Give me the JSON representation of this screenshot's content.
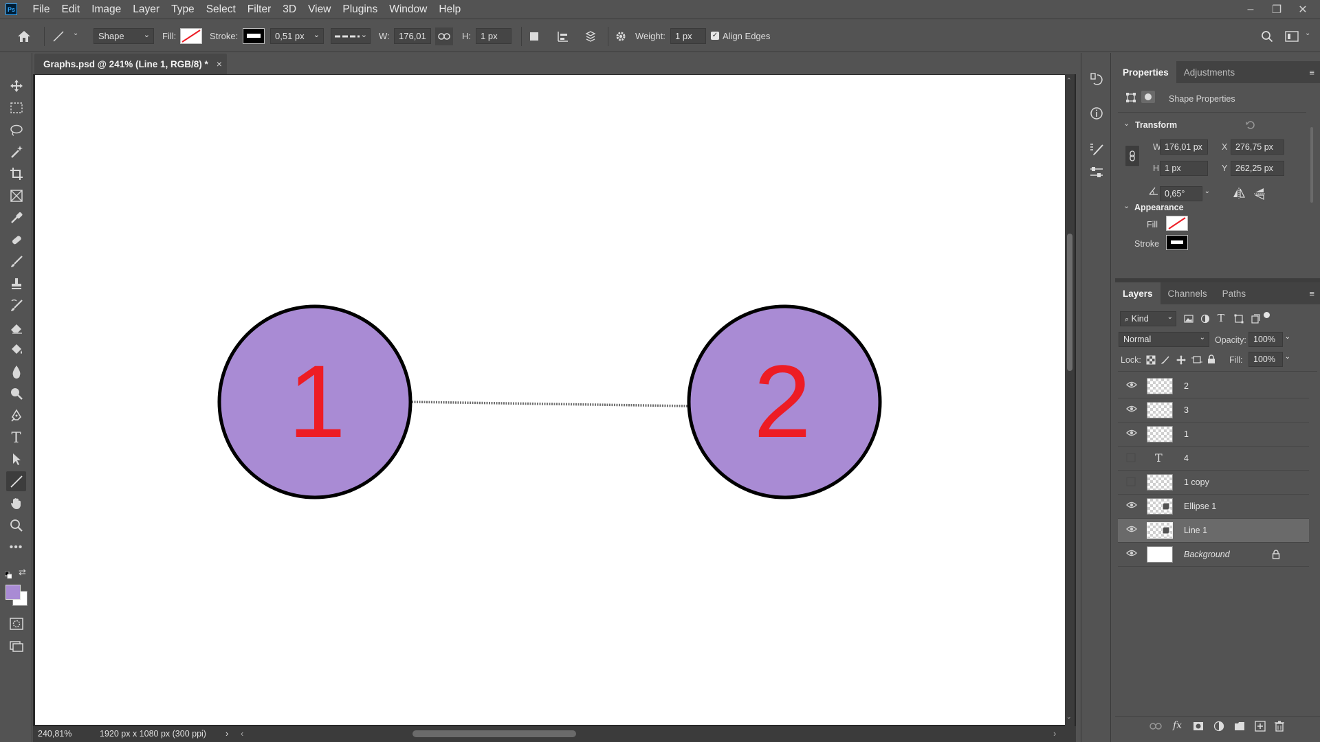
{
  "app": {
    "logo": "Ps",
    "menu": [
      "File",
      "Edit",
      "Image",
      "Layer",
      "Type",
      "Select",
      "Filter",
      "3D",
      "View",
      "Plugins",
      "Window",
      "Help"
    ],
    "window_controls": [
      "–",
      "❐",
      "✕"
    ]
  },
  "options_bar": {
    "tool_mode": "Shape",
    "fill_label": "Fill:",
    "stroke_label": "Stroke:",
    "stroke_width": "0,51 px",
    "w_label": "W:",
    "w_value": "176,01",
    "h_label": "H:",
    "h_value": "1 px",
    "weight_label": "Weight:",
    "weight_value": "1 px",
    "align_edges_label": "Align Edges",
    "align_edges_checked": true
  },
  "document": {
    "tab_title": "Graphs.psd @ 241% (Line 1, RGB/8) *",
    "close": "×",
    "zoom": "240,81%",
    "doc_info": "1920 px x 1080 px (300 ppi)",
    "nodes": [
      {
        "label": "1",
        "fill": "#a98bd4",
        "text_color": "#ed1c24"
      },
      {
        "label": "2",
        "fill": "#a98bd4",
        "text_color": "#ed1c24"
      }
    ]
  },
  "properties": {
    "tabs": [
      "Properties",
      "Adjustments"
    ],
    "subtitle": "Shape Properties",
    "transform_title": "Transform",
    "w_label": "W",
    "w_value": "176,01 px",
    "x_label": "X",
    "x_value": "276,75 px",
    "h_label": "H",
    "h_value": "1 px",
    "y_label": "Y",
    "y_value": "262,25 px",
    "angle_value": "0,65°",
    "appearance_title": "Appearance",
    "fill_label": "Fill",
    "stroke_label": "Stroke"
  },
  "layers": {
    "tabs": [
      "Layers",
      "Channels",
      "Paths"
    ],
    "kind_label": "Kind",
    "blend_mode": "Normal",
    "opacity_label": "Opacity:",
    "opacity_value": "100%",
    "lock_label": "Lock:",
    "fill_label": "Fill:",
    "fill_value": "100%",
    "items": [
      {
        "name": "2",
        "visible": true,
        "type": "pixel"
      },
      {
        "name": "3",
        "visible": true,
        "type": "pixel"
      },
      {
        "name": "1",
        "visible": true,
        "type": "pixel"
      },
      {
        "name": "4",
        "visible": false,
        "type": "text"
      },
      {
        "name": "1 copy",
        "visible": false,
        "type": "pixel"
      },
      {
        "name": "Ellipse 1",
        "visible": true,
        "type": "shape"
      },
      {
        "name": "Line 1",
        "visible": true,
        "type": "shape",
        "selected": true
      },
      {
        "name": "Background",
        "visible": true,
        "type": "background",
        "locked": true
      }
    ]
  },
  "colors": {
    "foreground": "#a98bd4",
    "background": "#ffffff"
  }
}
